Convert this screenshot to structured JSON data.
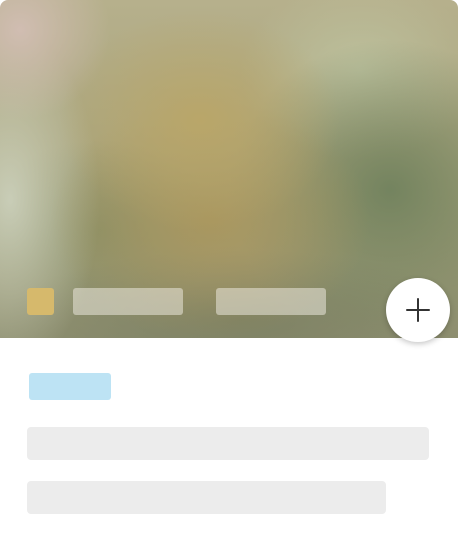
{
  "colors": {
    "swatch": "#d6b96c",
    "tag": "#bde3f4",
    "placeholder": "#ececec",
    "button_icon": "#333333"
  },
  "hero": {
    "add_button_icon": "plus-icon"
  }
}
